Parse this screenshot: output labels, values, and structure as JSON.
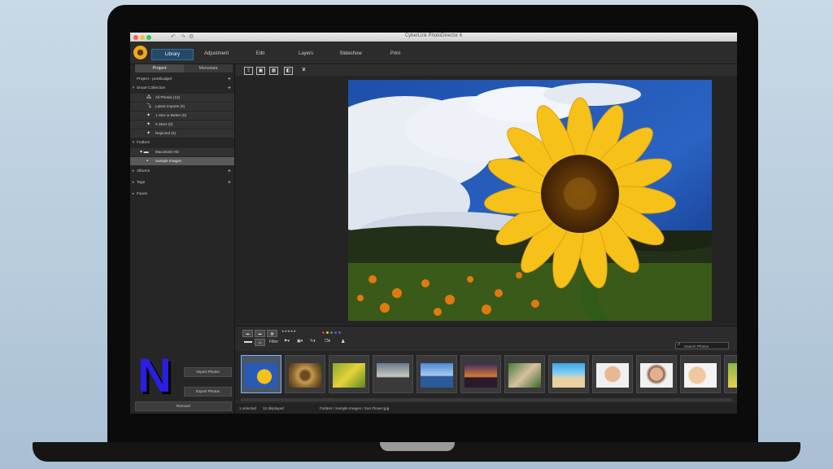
{
  "window": {
    "title": "CyberLink PhotoDirector 6"
  },
  "modes": [
    {
      "label": "Library",
      "active": true
    },
    {
      "label": "Adjustment",
      "active": false
    },
    {
      "label": "Edit",
      "active": false
    },
    {
      "label": "Layers",
      "active": false
    },
    {
      "label": "Slideshow",
      "active": false
    },
    {
      "label": "Print",
      "active": false
    }
  ],
  "panel": {
    "tabs": [
      "Project",
      "Metadata"
    ],
    "project_label": "Project - prosbudget",
    "smart_collection": "Smart Collection",
    "smart_items": [
      {
        "label": "All Photos (13)"
      },
      {
        "label": "Latest Imports (0)"
      },
      {
        "label": "1 Star or Better (0)"
      },
      {
        "label": "5 Stars (0)"
      },
      {
        "label": "Rejected (0)"
      }
    ],
    "folders": "Folders",
    "folder_items": [
      {
        "label": "Macintosh HD"
      },
      {
        "label": "Sample Images"
      }
    ],
    "albums": "Albums",
    "tags": "Tags",
    "faces": "Faces",
    "buttons": [
      "Import Photos",
      "Export Photos",
      "Remove"
    ]
  },
  "filter": {
    "label": "Filter",
    "search_placeholder": "Search Photos"
  },
  "colors": {
    "accent": "#234a6b",
    "selection": "#7fb0ff",
    "badge": "#2b1ee0"
  },
  "status": {
    "selected": "1 selected",
    "displayed": "13 displayed",
    "path": "Folders / Sample Images / Sun Flower.jpg"
  },
  "badge": {
    "letter": "N"
  }
}
